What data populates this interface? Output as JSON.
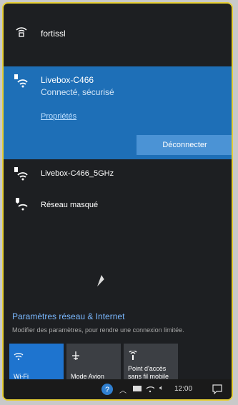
{
  "top_network": {
    "name": "fortissl"
  },
  "selected_network": {
    "name": "Livebox-C466",
    "status": "Connecté, sécurisé",
    "properties_link": "Propriétés",
    "disconnect_button": "Déconnecter"
  },
  "networks": [
    {
      "name": "Livebox-C466_5GHz"
    },
    {
      "name": "Réseau masqué"
    }
  ],
  "settings": {
    "title": "Paramètres réseau & Internet",
    "subtitle": "Modifier des paramètres, pour rendre une connexion limitée."
  },
  "quick_actions": [
    {
      "label": "Wi-Fi",
      "active": true
    },
    {
      "label": "Mode Avion",
      "active": false
    },
    {
      "label_line1": "Point d'accès",
      "label_line2": "sans fil mobile",
      "active": false
    }
  ],
  "taskbar": {
    "time": "12:00"
  },
  "colors": {
    "accent": "#1e6fb7",
    "button": "#4b93d5",
    "panel": "#1d1f22",
    "link": "#7ab8ff",
    "frame": "#e6cf35"
  }
}
